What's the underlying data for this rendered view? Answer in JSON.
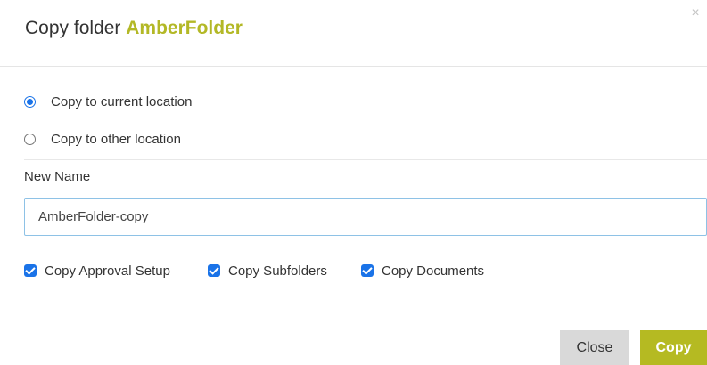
{
  "dialog": {
    "title_prefix": "Copy folder",
    "folder_name": "AmberFolder",
    "close_icon": "×"
  },
  "location_options": [
    {
      "label": "Copy to current location",
      "selected": true
    },
    {
      "label": "Copy to other location",
      "selected": false
    }
  ],
  "new_name": {
    "label": "New Name",
    "value": "AmberFolder-copy"
  },
  "options": [
    {
      "label": "Copy Approval Setup",
      "checked": true
    },
    {
      "label": "Copy Subfolders",
      "checked": true
    },
    {
      "label": "Copy Documents",
      "checked": true
    }
  ],
  "buttons": {
    "close_label": "Close",
    "copy_label": "Copy"
  },
  "colors": {
    "accent": "#b5ba22",
    "checkbox_blue": "#1a73e8",
    "input_border": "#8ec2e6",
    "close_button_bg": "#d9d9d9"
  }
}
